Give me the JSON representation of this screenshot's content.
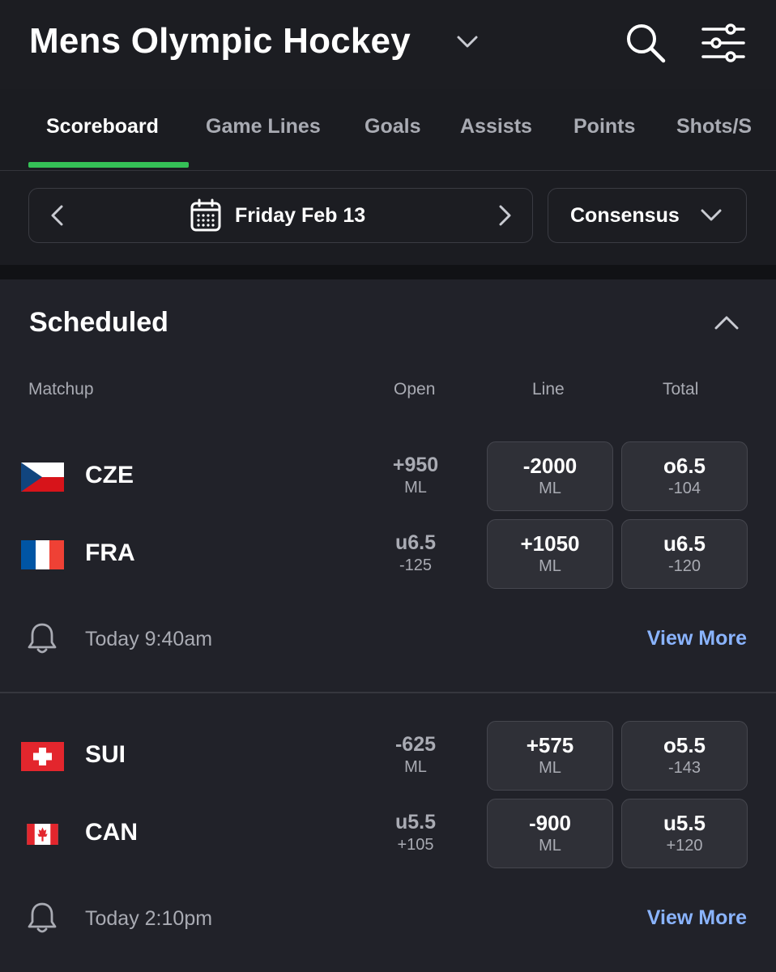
{
  "header": {
    "title": "Mens Olympic Hockey",
    "icons": {
      "dropdown": "chevron-down-icon",
      "search": "search-icon",
      "filter": "sliders-icon"
    }
  },
  "tabs": [
    {
      "label": "Scoreboard",
      "active": true
    },
    {
      "label": "Game Lines",
      "active": false
    },
    {
      "label": "Goals",
      "active": false
    },
    {
      "label": "Assists",
      "active": false
    },
    {
      "label": "Points",
      "active": false
    },
    {
      "label": "Shots/S",
      "active": false
    }
  ],
  "date_nav": {
    "label": "Friday Feb 13"
  },
  "sportsbook": {
    "label": "Consensus"
  },
  "section": {
    "title": "Scheduled",
    "columns": {
      "matchup": "Matchup",
      "open": "Open",
      "line": "Line",
      "total": "Total"
    }
  },
  "games": [
    {
      "teams": [
        {
          "name": "CZE",
          "flag": "czech-flag",
          "open_main": "+950",
          "open_sub": "ML",
          "line_main": "-2000",
          "line_sub": "ML",
          "total_main": "o6.5",
          "total_sub": "-104"
        },
        {
          "name": "FRA",
          "flag": "france-flag",
          "open_main": "u6.5",
          "open_sub": "-125",
          "line_main": "+1050",
          "line_sub": "ML",
          "total_main": "u6.5",
          "total_sub": "-120"
        }
      ],
      "time": "Today 9:40am",
      "view_more": "View More"
    },
    {
      "teams": [
        {
          "name": "SUI",
          "flag": "switzerland-flag",
          "open_main": "-625",
          "open_sub": "ML",
          "line_main": "+575",
          "line_sub": "ML",
          "total_main": "o5.5",
          "total_sub": "-143"
        },
        {
          "name": "CAN",
          "flag": "canada-flag",
          "open_main": "u5.5",
          "open_sub": "+105",
          "line_main": "-900",
          "line_sub": "ML",
          "total_main": "u5.5",
          "total_sub": "+120"
        }
      ],
      "time": "Today 2:10pm",
      "view_more": "View More"
    }
  ],
  "colors": {
    "accent_green": "#35c157",
    "link_blue": "#8ab4ff",
    "background": "#212229"
  }
}
